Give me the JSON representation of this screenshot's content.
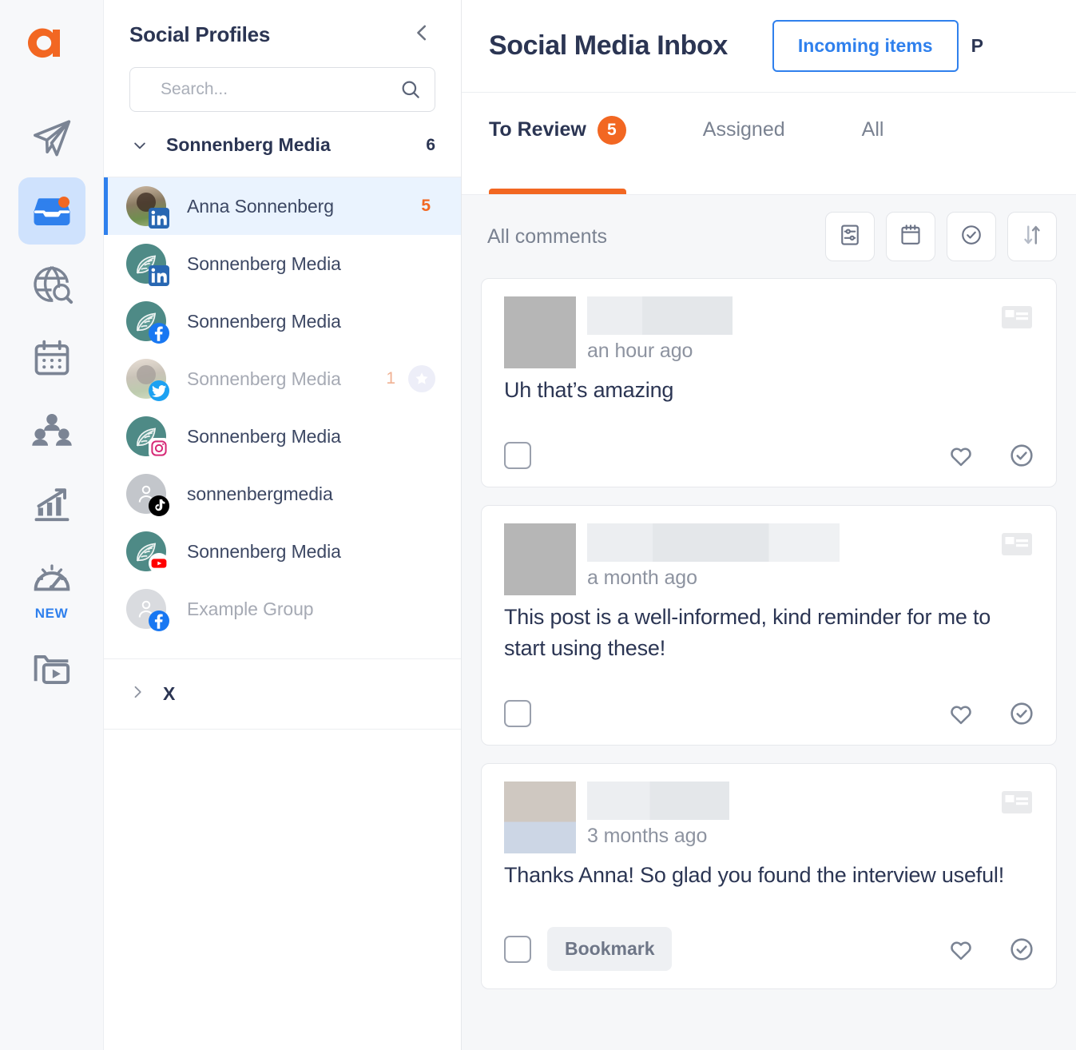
{
  "rail": {
    "logo": "agorapulse-logo-a",
    "items": [
      {
        "name": "publishing",
        "icon": "paper-plane-icon",
        "active": false,
        "badge": false
      },
      {
        "name": "inbox",
        "icon": "inbox-icon",
        "active": true,
        "badge": true
      },
      {
        "name": "listening",
        "icon": "globe-search-icon",
        "active": false,
        "badge": false
      },
      {
        "name": "calendar",
        "icon": "calendar-icon",
        "active": false,
        "badge": false
      },
      {
        "name": "team",
        "icon": "users-icon",
        "active": false,
        "badge": false
      },
      {
        "name": "reports",
        "icon": "bar-chart-up-icon",
        "active": false,
        "badge": false
      },
      {
        "name": "monitoring",
        "icon": "gauge-icon",
        "active": false,
        "badge": false,
        "tag": "NEW"
      },
      {
        "name": "media-library",
        "icon": "folder-video-icon",
        "active": false,
        "badge": false
      }
    ],
    "new_tag": "NEW"
  },
  "profiles": {
    "title": "Social Profiles",
    "collapse_icon": "chevron-left-icon",
    "search": {
      "placeholder": "Search...",
      "value": "",
      "icon": "search-icon"
    },
    "group": {
      "chevron": "chevron-down-icon",
      "name": "Sonnenberg Media",
      "count": "6"
    },
    "items": [
      {
        "name": "Anna Sonnenberg",
        "platform": "linkedin",
        "avatar": "photo",
        "count": "5",
        "selected": true,
        "muted": false,
        "star": false
      },
      {
        "name": "Sonnenberg Media",
        "platform": "linkedin",
        "avatar": "leaf",
        "count": "",
        "selected": false,
        "muted": false,
        "star": false
      },
      {
        "name": "Sonnenberg Media",
        "platform": "facebook",
        "avatar": "leaf",
        "count": "",
        "selected": false,
        "muted": false,
        "star": false
      },
      {
        "name": "Sonnenberg Media",
        "platform": "twitter",
        "avatar": "photo-dim",
        "count": "1",
        "selected": false,
        "muted": true,
        "star": true
      },
      {
        "name": "Sonnenberg Media",
        "platform": "instagram",
        "avatar": "leaf",
        "count": "",
        "selected": false,
        "muted": false,
        "star": false
      },
      {
        "name": "sonnenbergmedia",
        "platform": "tiktok",
        "avatar": "grey-person",
        "count": "",
        "selected": false,
        "muted": false,
        "star": false
      },
      {
        "name": "Sonnenberg Media",
        "platform": "youtube",
        "avatar": "leaf",
        "count": "",
        "selected": false,
        "muted": false,
        "star": false
      },
      {
        "name": "Example Group",
        "platform": "facebook",
        "avatar": "grey-person-light",
        "count": "",
        "selected": false,
        "muted": true,
        "star": false
      }
    ],
    "x_group": {
      "chevron": "chevron-right-icon",
      "name": "X"
    }
  },
  "main": {
    "title": "Social Media Inbox",
    "incoming_button": "Incoming items",
    "cut_button": "P",
    "tabs": [
      {
        "label": "To Review",
        "badge": "5",
        "active": true
      },
      {
        "label": "Assigned",
        "badge": "",
        "active": false
      },
      {
        "label": "All",
        "badge": "",
        "active": false
      }
    ],
    "toolbar": {
      "label": "All comments",
      "buttons": [
        {
          "name": "filter-sliders-icon"
        },
        {
          "name": "calendar-icon"
        },
        {
          "name": "check-circle-icon"
        },
        {
          "name": "sort-arrows-icon"
        }
      ]
    },
    "cards": [
      {
        "author_redacted": true,
        "avatar_style": "plain",
        "name_width": "w1",
        "timestamp": "an hour ago",
        "text": "Uh that’s amazing",
        "bookmark": "",
        "platform_badge": "redacted-badge-icon",
        "actions": [
          {
            "name": "like-heart-icon"
          },
          {
            "name": "review-check-icon"
          }
        ],
        "checkbox": "select-comment-checkbox"
      },
      {
        "author_redacted": true,
        "avatar_style": "plain",
        "name_width": "w2",
        "timestamp": "a month ago",
        "text": "This post is a well-informed, kind reminder for me to start using these!",
        "bookmark": "",
        "platform_badge": "redacted-badge-icon",
        "actions": [
          {
            "name": "like-heart-icon"
          },
          {
            "name": "review-check-icon"
          }
        ],
        "checkbox": "select-comment-checkbox"
      },
      {
        "author_redacted": true,
        "avatar_style": "split",
        "name_width": "w3",
        "timestamp": "3 months ago",
        "text": "Thanks Anna! So glad you found the interview useful!",
        "bookmark": "Bookmark",
        "platform_badge": "redacted-badge-icon",
        "actions": [
          {
            "name": "like-heart-icon"
          },
          {
            "name": "review-check-icon"
          }
        ],
        "checkbox": "select-comment-checkbox"
      }
    ]
  },
  "colors": {
    "brand_orange": "#f26722",
    "accent_blue": "#2f80ed",
    "text_dark": "#2b3553",
    "text_muted": "#7a8291",
    "panel_bg": "#f6f7f9"
  }
}
